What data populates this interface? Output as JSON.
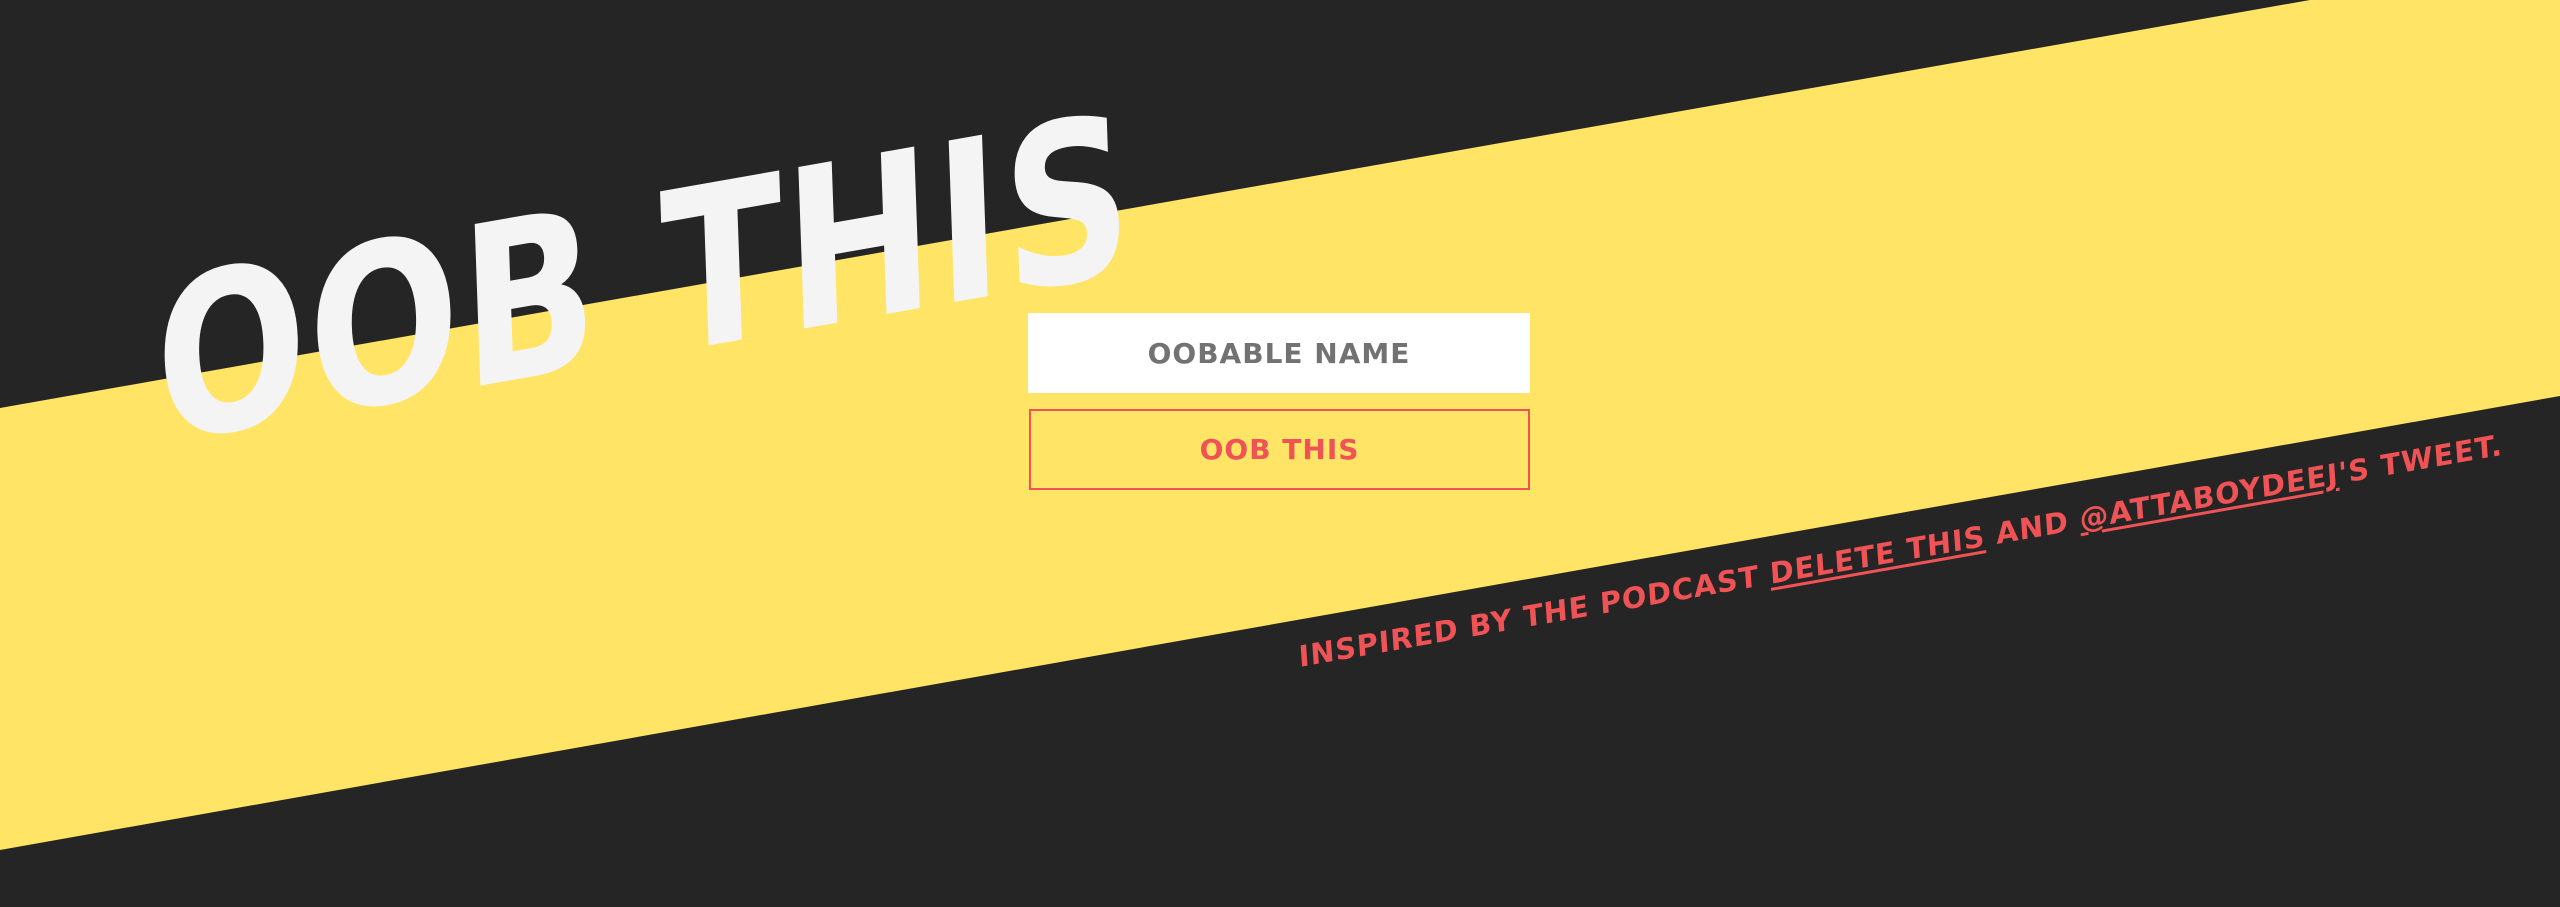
{
  "colors": {
    "background": "#252525",
    "stripe": "#ffe465",
    "title": "#f4f4f4",
    "accent": "#ef5356",
    "input_bg": "#ffffff",
    "input_text": "#727272"
  },
  "header": {
    "title": "OOB THIS"
  },
  "form": {
    "name_placeholder": "OOBABLE NAME",
    "submit_label": "OOB THIS"
  },
  "credit": {
    "prefix": "INSPIRED BY THE PODCAST ",
    "podcast_link": "DELETE THIS",
    "middle": " AND ",
    "twitter_link": "@ATTABOYDEEJ",
    "suffix": "'S TWEET."
  }
}
